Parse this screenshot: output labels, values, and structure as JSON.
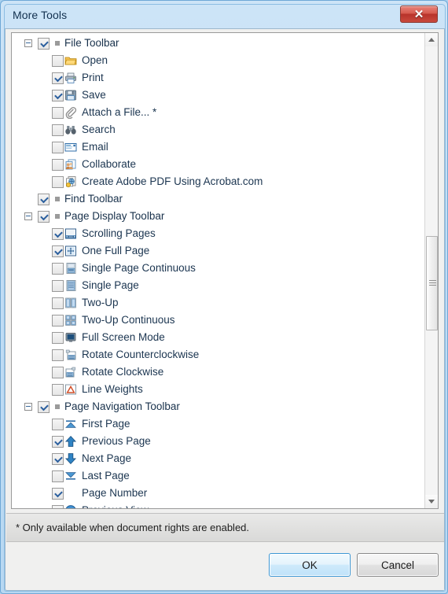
{
  "window": {
    "title": "More Tools",
    "close_label": "✕",
    "close_icon": "close-icon"
  },
  "tree": {
    "items": [
      {
        "level": "parent",
        "expander": "minus",
        "checked": true,
        "marker": true,
        "icon": null,
        "label": "File Toolbar"
      },
      {
        "level": "child",
        "expander": null,
        "checked": false,
        "marker": false,
        "icon": "folder-open-icon",
        "label": "Open"
      },
      {
        "level": "child",
        "expander": null,
        "checked": true,
        "marker": false,
        "icon": "printer-icon",
        "label": "Print"
      },
      {
        "level": "child",
        "expander": null,
        "checked": true,
        "marker": false,
        "icon": "floppy-save-icon",
        "label": "Save"
      },
      {
        "level": "child",
        "expander": null,
        "checked": false,
        "marker": false,
        "icon": "paperclip-icon",
        "label": "Attach a File... *"
      },
      {
        "level": "child",
        "expander": null,
        "checked": false,
        "marker": false,
        "icon": "binoculars-icon",
        "label": "Search"
      },
      {
        "level": "child",
        "expander": null,
        "checked": false,
        "marker": false,
        "icon": "envelope-icon",
        "label": "Email"
      },
      {
        "level": "child",
        "expander": null,
        "checked": false,
        "marker": false,
        "icon": "collaborate-icon",
        "label": "Collaborate"
      },
      {
        "level": "child",
        "expander": null,
        "checked": false,
        "marker": false,
        "icon": "create-pdf-icon",
        "label": "Create Adobe PDF Using Acrobat.com"
      },
      {
        "level": "parent-noexp",
        "expander": null,
        "checked": true,
        "marker": true,
        "icon": null,
        "label": "Find Toolbar"
      },
      {
        "level": "parent",
        "expander": "minus",
        "checked": true,
        "marker": true,
        "icon": null,
        "label": "Page Display Toolbar"
      },
      {
        "level": "child",
        "expander": null,
        "checked": true,
        "marker": false,
        "icon": "scrolling-pages-icon",
        "label": "Scrolling Pages"
      },
      {
        "level": "child",
        "expander": null,
        "checked": true,
        "marker": false,
        "icon": "one-full-page-icon",
        "label": "One Full Page"
      },
      {
        "level": "child",
        "expander": null,
        "checked": false,
        "marker": false,
        "icon": "single-page-continuous-icon",
        "label": "Single Page Continuous"
      },
      {
        "level": "child",
        "expander": null,
        "checked": false,
        "marker": false,
        "icon": "single-page-icon",
        "label": "Single Page"
      },
      {
        "level": "child",
        "expander": null,
        "checked": false,
        "marker": false,
        "icon": "two-up-icon",
        "label": "Two-Up"
      },
      {
        "level": "child",
        "expander": null,
        "checked": false,
        "marker": false,
        "icon": "two-up-continuous-icon",
        "label": "Two-Up Continuous"
      },
      {
        "level": "child",
        "expander": null,
        "checked": false,
        "marker": false,
        "icon": "full-screen-icon",
        "label": "Full Screen Mode"
      },
      {
        "level": "child",
        "expander": null,
        "checked": false,
        "marker": false,
        "icon": "rotate-ccw-icon",
        "label": "Rotate Counterclockwise"
      },
      {
        "level": "child",
        "expander": null,
        "checked": false,
        "marker": false,
        "icon": "rotate-cw-icon",
        "label": "Rotate Clockwise"
      },
      {
        "level": "child",
        "expander": null,
        "checked": false,
        "marker": false,
        "icon": "line-weights-icon",
        "label": "Line Weights"
      },
      {
        "level": "parent",
        "expander": "minus",
        "checked": true,
        "marker": true,
        "icon": null,
        "label": "Page Navigation Toolbar"
      },
      {
        "level": "child",
        "expander": null,
        "checked": false,
        "marker": false,
        "icon": "first-page-icon",
        "label": "First Page"
      },
      {
        "level": "child",
        "expander": null,
        "checked": true,
        "marker": false,
        "icon": "previous-page-icon",
        "label": "Previous Page"
      },
      {
        "level": "child",
        "expander": null,
        "checked": true,
        "marker": false,
        "icon": "next-page-icon",
        "label": "Next Page"
      },
      {
        "level": "child",
        "expander": null,
        "checked": false,
        "marker": false,
        "icon": "last-page-icon",
        "label": "Last Page"
      },
      {
        "level": "child",
        "expander": null,
        "checked": true,
        "marker": false,
        "icon": null,
        "label": "Page Number"
      },
      {
        "level": "child",
        "expander": null,
        "checked": false,
        "marker": false,
        "icon": "previous-view-icon",
        "label": "Previous View"
      }
    ]
  },
  "scrollbar": {
    "up_arrow": "scroll-up-arrow",
    "down_arrow": "scroll-down-arrow"
  },
  "footer": {
    "note": "* Only available when document rights are enabled."
  },
  "buttons": {
    "ok_label": "OK",
    "cancel_label": "Cancel"
  },
  "colors": {
    "title_bar_blue": "#c2ddf4",
    "close_red": "#c9493d",
    "check_blue": "#2b5f9e",
    "ok_border_blue": "#3c97d4",
    "text_dark": "#18314b"
  }
}
